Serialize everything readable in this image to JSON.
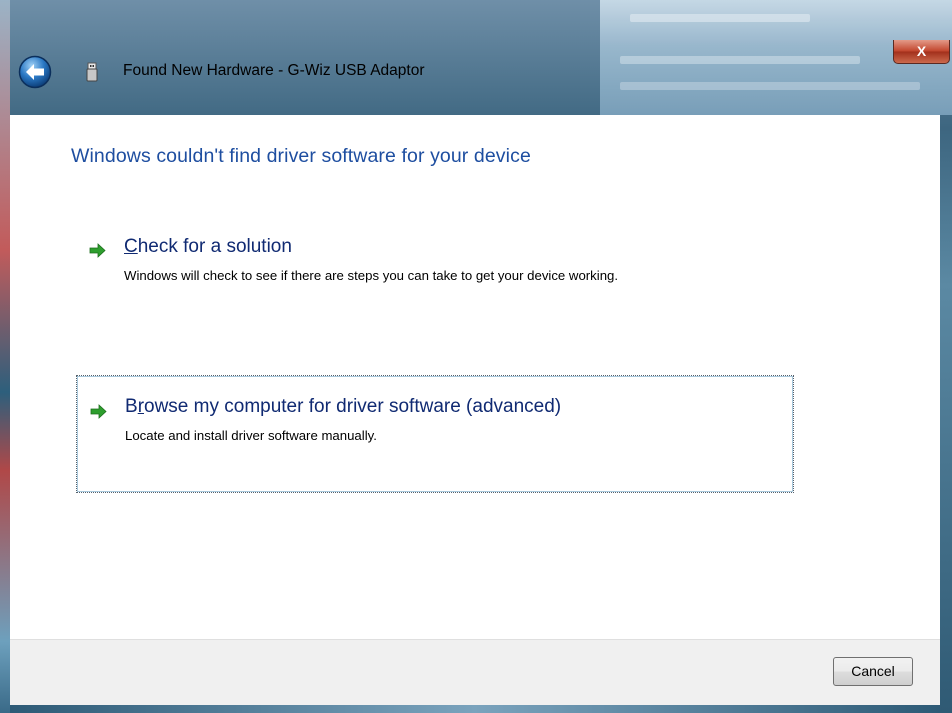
{
  "window": {
    "title": "Found New Hardware - G-Wiz USB Adaptor",
    "close_label": "X"
  },
  "icons": {
    "back": "back-arrow-icon",
    "device": "usb-device-icon",
    "option_arrow": "green-arrow-icon"
  },
  "main": {
    "heading": "Windows couldn't find driver software for your device",
    "options": [
      {
        "title_accel": "C",
        "title_rest": "heck for a solution",
        "description": "Windows will check to see if there are steps you can take to get your device working."
      },
      {
        "title_lead": "B",
        "title_accel": "r",
        "title_rest": "owse my computer for driver software (advanced)",
        "description": "Locate and install driver software manually."
      }
    ]
  },
  "footer": {
    "cancel_label": "Cancel"
  },
  "colors": {
    "heading": "#1e4ea0",
    "option_title": "#102a72",
    "arrow": "#2e9e2e"
  }
}
